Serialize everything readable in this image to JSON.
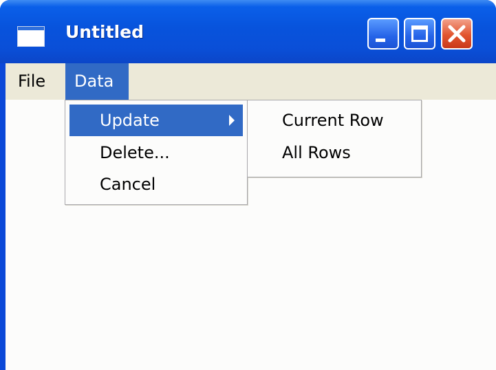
{
  "window": {
    "title": "Untitled"
  },
  "titlebar_buttons": {
    "minimize_icon": "minimize-icon",
    "maximize_icon": "maximize-icon",
    "close_icon": "close-icon"
  },
  "menubar": {
    "items": [
      {
        "label": "File",
        "active": false
      },
      {
        "label": "Data",
        "active": true
      }
    ]
  },
  "data_menu": {
    "items": [
      {
        "label": "Update",
        "highlighted": true,
        "has_submenu": true
      },
      {
        "label": "Delete...",
        "highlighted": false,
        "has_submenu": false
      },
      {
        "label": "Cancel",
        "highlighted": false,
        "has_submenu": false
      }
    ]
  },
  "update_submenu": {
    "items": [
      {
        "label": "Current Row"
      },
      {
        "label": "All Rows"
      }
    ]
  },
  "colors": {
    "titlebar": "#0853dc",
    "highlight": "#316ac5",
    "menubar": "#ece9d8",
    "close_button": "#e2552f"
  }
}
